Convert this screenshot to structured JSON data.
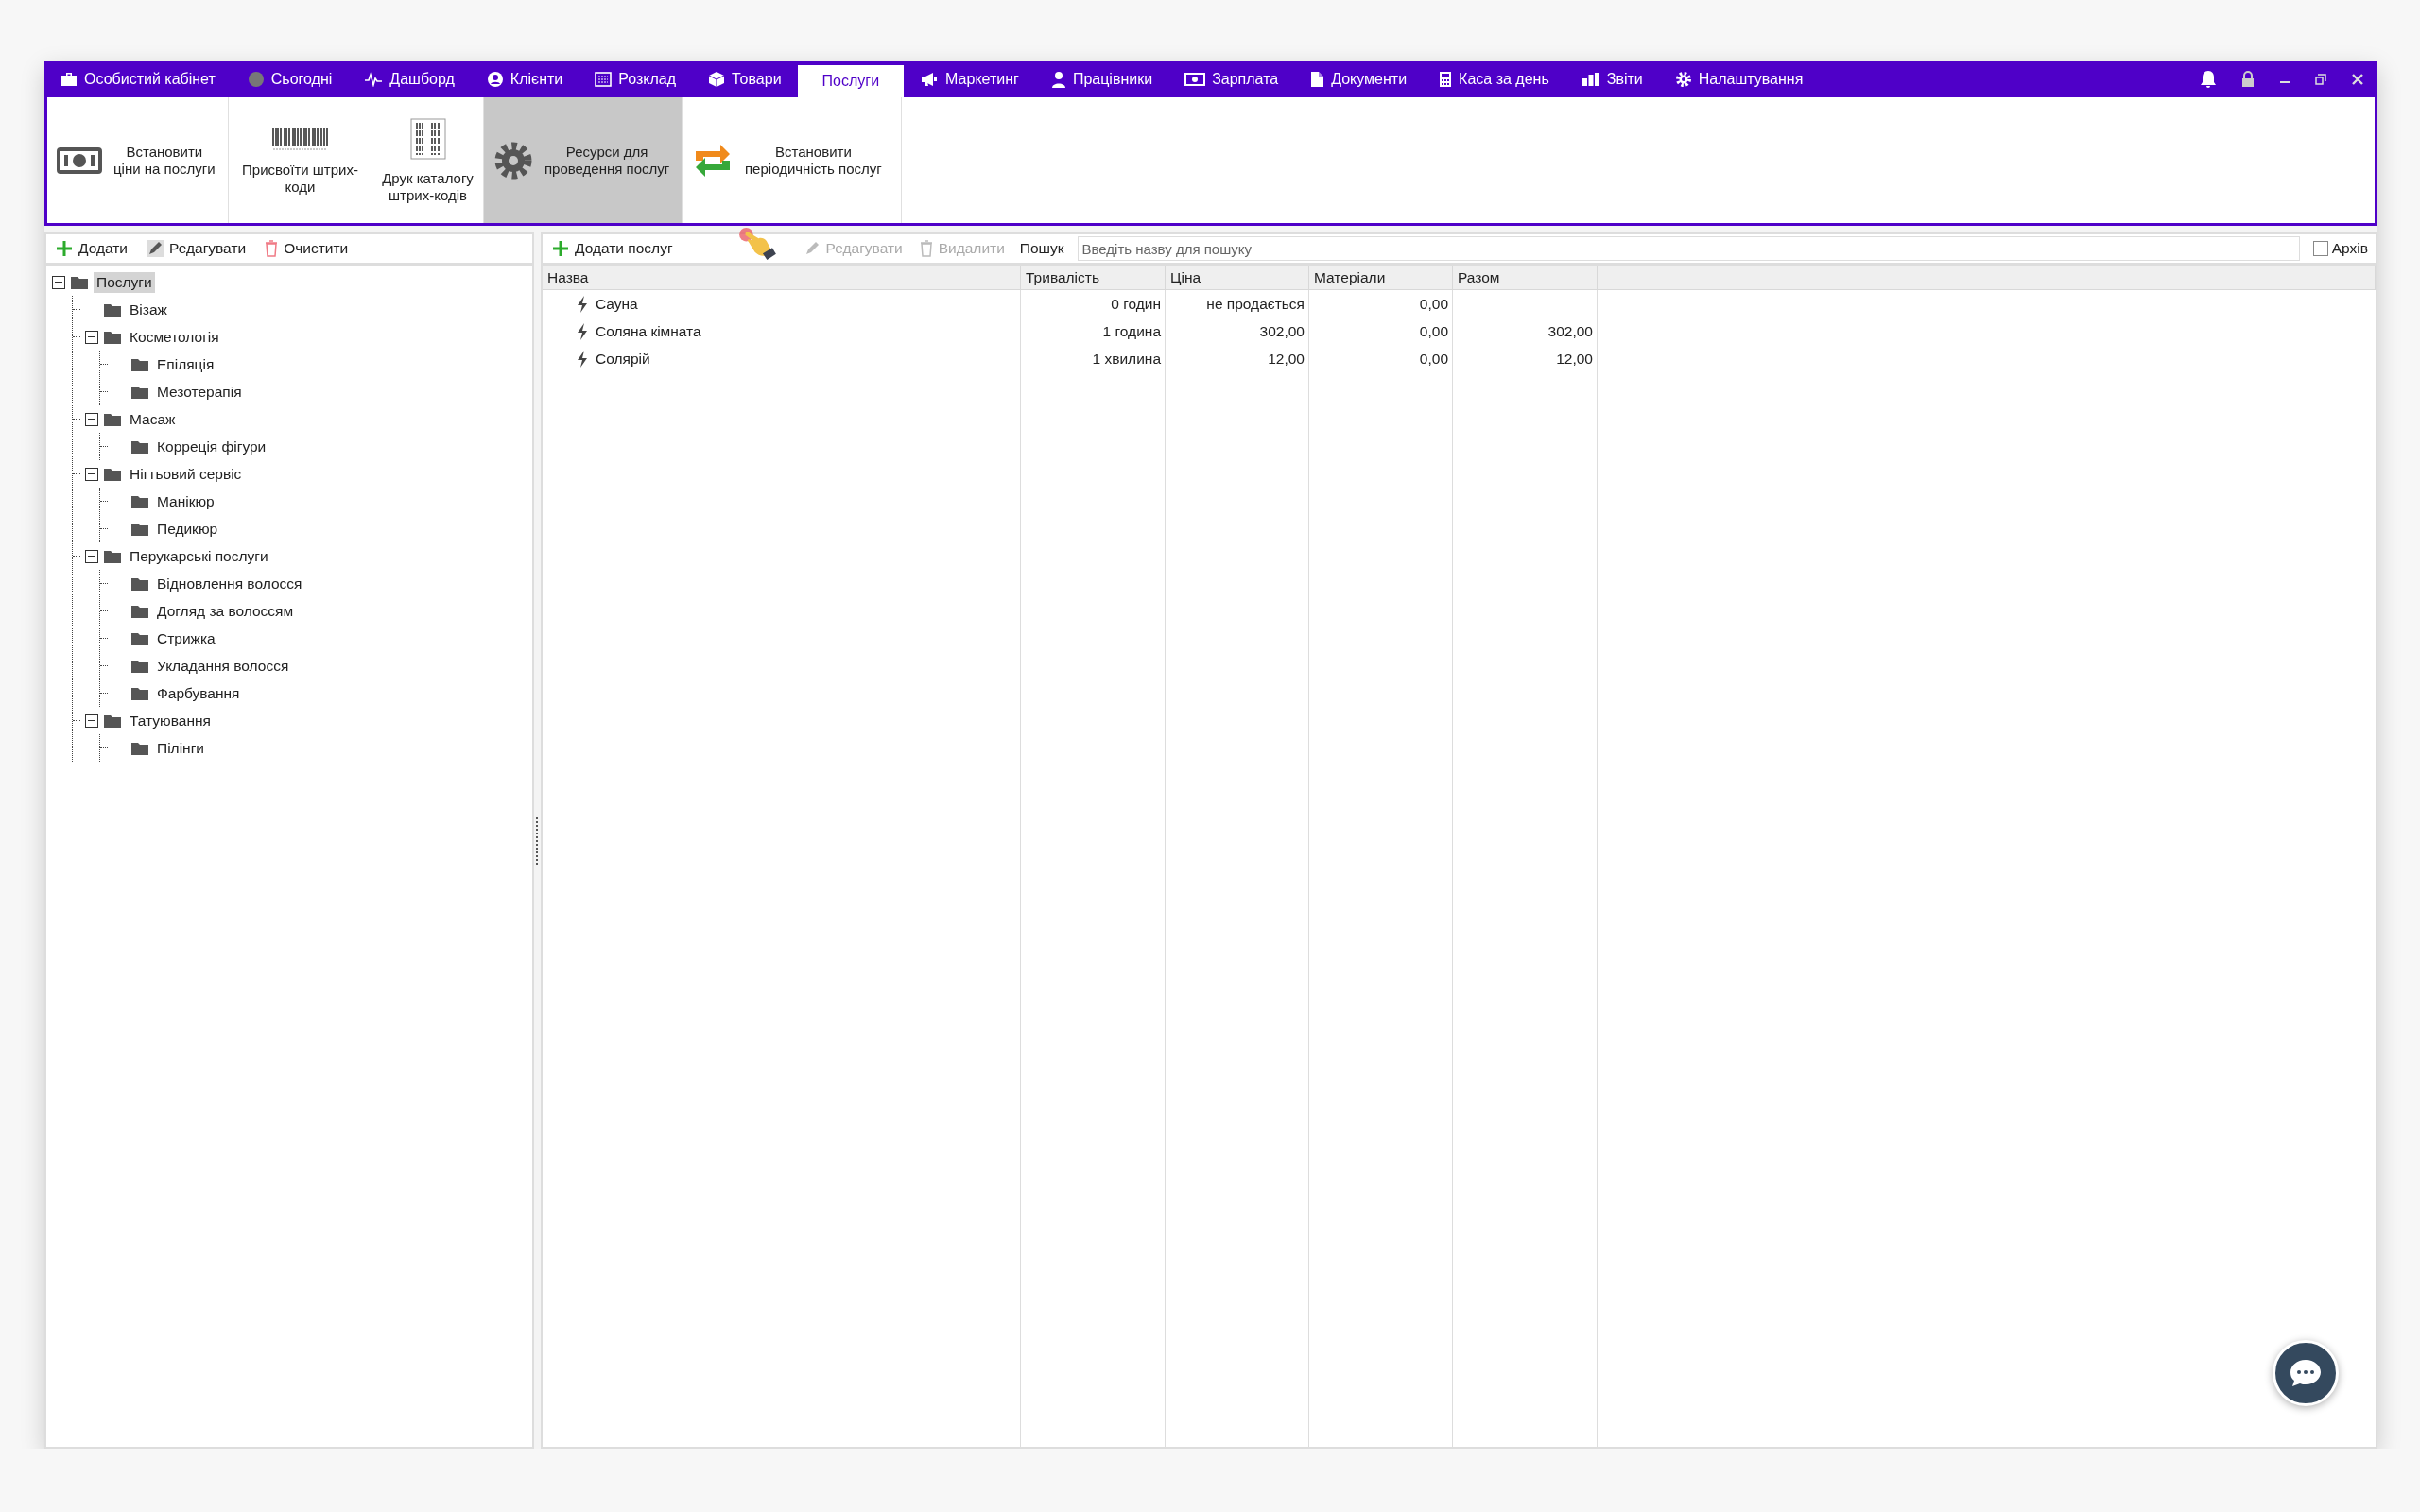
{
  "menu": [
    {
      "label": "Особистий кабінет",
      "selected": false
    },
    {
      "label": "Сьогодні",
      "selected": false
    },
    {
      "label": "Дашборд",
      "selected": false
    },
    {
      "label": "Клієнти",
      "selected": false
    },
    {
      "label": "Розклад",
      "selected": false
    },
    {
      "label": "Товари",
      "selected": false
    },
    {
      "label": "Послуги",
      "selected": true
    },
    {
      "label": "Маркетинг",
      "selected": false
    },
    {
      "label": "Працівники",
      "selected": false
    },
    {
      "label": "Зарплата",
      "selected": false
    },
    {
      "label": "Документи",
      "selected": false
    },
    {
      "label": "Каса за день",
      "selected": false
    },
    {
      "label": "Звіти",
      "selected": false
    },
    {
      "label": "Налаштування",
      "selected": false
    }
  ],
  "ribbon": [
    {
      "label": "Встановити\nціни на послуги",
      "kind": "side",
      "selected": false
    },
    {
      "label": "Присвоїти штрих-\nкоди",
      "kind": "top",
      "selected": false
    },
    {
      "label": "Друк каталогу\nштрих-кодів",
      "kind": "top",
      "selected": false
    },
    {
      "label": "Ресурси для\nпроведення послуг",
      "kind": "side",
      "selected": true
    },
    {
      "label": "Встановити\nперіодичність послуг",
      "kind": "side",
      "selected": false
    }
  ],
  "tree_toolbar": [
    "Додати",
    "Редагувати",
    "Очистити"
  ],
  "tree": [
    {
      "label": "Послуги",
      "selected": true,
      "expanded": true,
      "children": [
        {
          "label": "Візаж",
          "selected": false
        },
        {
          "label": "Косметологія",
          "selected": false,
          "expanded": true,
          "children": [
            {
              "label": "Епіляція",
              "selected": false
            },
            {
              "label": "Мезотерапія",
              "selected": false
            }
          ]
        },
        {
          "label": "Масаж",
          "selected": false,
          "expanded": true,
          "children": [
            {
              "label": "Корреція фігури",
              "selected": false
            }
          ]
        },
        {
          "label": "Нігтьовий сервіс",
          "selected": false,
          "expanded": true,
          "children": [
            {
              "label": "Манікюр",
              "selected": false
            },
            {
              "label": "Педикюр",
              "selected": false
            }
          ]
        },
        {
          "label": "Перукарські послуги",
          "selected": false,
          "expanded": true,
          "children": [
            {
              "label": "Відновлення волосся",
              "selected": false
            },
            {
              "label": "Догляд за волоссям",
              "selected": false
            },
            {
              "label": "Стрижка",
              "selected": false
            },
            {
              "label": "Укладання волосся",
              "selected": false
            },
            {
              "label": "Фарбування",
              "selected": false
            }
          ]
        },
        {
          "label": "Татуювання",
          "selected": false,
          "expanded": true,
          "children": [
            {
              "label": "Пілінги",
              "selected": false
            }
          ]
        }
      ]
    }
  ],
  "services_toolbar": [
    {
      "label": "Додати послуг",
      "disabled": false
    },
    {
      "label": "Редагувати",
      "disabled": true
    },
    {
      "label": "Видалити",
      "disabled": true
    }
  ],
  "search": {
    "label": "Пошук",
    "placeholder": "Введіть назву для пошуку"
  },
  "archive": {
    "label": "Архів",
    "checked": false
  },
  "table": {
    "columns": [
      "Назва",
      "Тривалість",
      "Ціна",
      "Матеріали",
      "Разом"
    ],
    "rows": [
      [
        "Сауна",
        "0 годин",
        "не продається",
        "0,00",
        ""
      ],
      [
        "Соляна кімната",
        "1 година",
        "302,00",
        "0,00",
        "302,00"
      ],
      [
        "Солярій",
        "1 хвилина",
        "12,00",
        "0,00",
        "12,00"
      ]
    ]
  }
}
